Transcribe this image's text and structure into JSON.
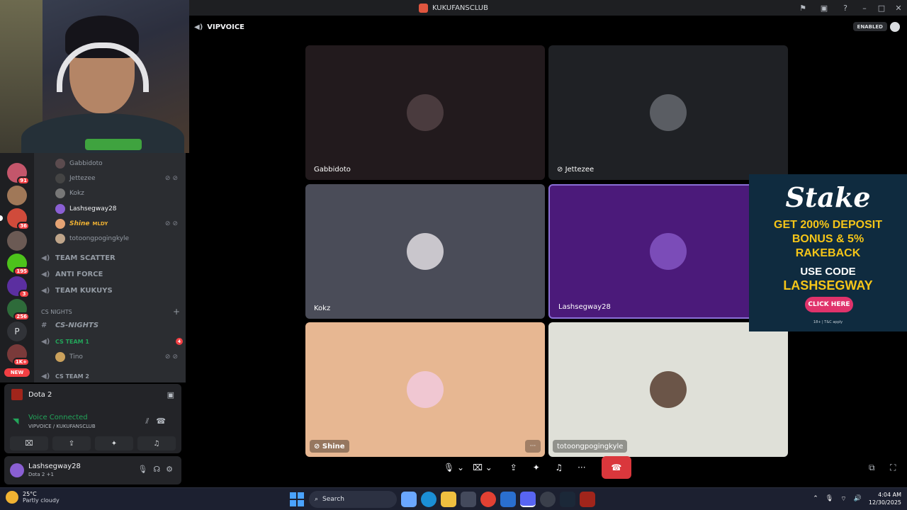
{
  "window": {
    "title": "KUKUFANSCLUB"
  },
  "call": {
    "channel_name": "VIPVOICE",
    "enabled_label": "ENABLED",
    "tiles": [
      {
        "name": "Gabbidoto",
        "bg": "#221a1d"
      },
      {
        "name": "Jettezee",
        "bg": "#1f2125",
        "muted_icon": "video-off-icon"
      },
      {
        "name": "Kokz",
        "bg": "#4a4c58"
      },
      {
        "name": "Lashsegway28",
        "bg": "#4b1a7a"
      },
      {
        "name": "Shine",
        "bg": "#e7b792",
        "muted_icon": "video-off-icon"
      },
      {
        "name": "totoongpogingkyle",
        "bg": "#dfe0d8"
      }
    ],
    "more_label": "···"
  },
  "members": [
    {
      "name": "Gabbidoto"
    },
    {
      "name": "Jettezee"
    },
    {
      "name": "Kokz"
    },
    {
      "name": "Lashsegway28"
    },
    {
      "name": "Shine",
      "tag": "MLDY"
    },
    {
      "name": "totoongpogingkyle"
    }
  ],
  "voice_channels": [
    {
      "name": "TEAM SCATTER"
    },
    {
      "name": "ANTI FORCE"
    },
    {
      "name": "TEAM KUKUYS"
    }
  ],
  "category": {
    "name": "CS NIGHTS",
    "text_channel": "CS-NIGHTS",
    "voice_1": "CS TEAM 1",
    "voice_1_badge": "4",
    "voice_1_member": "Tino",
    "voice_2": "CS TEAM 2"
  },
  "servers": [
    {
      "badge": "91"
    },
    {
      "badge": ""
    },
    {
      "badge": "36"
    },
    {
      "badge": ""
    },
    {
      "badge": "195"
    },
    {
      "badge": "3"
    },
    {
      "badge": "256"
    },
    {
      "letter": "P"
    },
    {
      "badge": "1K+"
    }
  ],
  "new_label": "NEW",
  "activity": {
    "game": "Dota 2"
  },
  "voice_panel": {
    "status": "Voice Connected",
    "location": "VIPVOICE / KUKUFANSCLUB"
  },
  "user": {
    "name": "Lashsegway28",
    "status": "Dota 2 +1"
  },
  "ad": {
    "brand": "Stake",
    "line1": "GET 200% DEPOSIT",
    "line2": "BONUS & 5%",
    "line3": "RAKEBACK",
    "line4": "USE CODE",
    "line5": "LASHSEGWAY",
    "cta": "CLICK HERE",
    "fine": "18+ | T&C apply"
  },
  "taskbar": {
    "temp": "25°C",
    "weather": "Partly cloudy",
    "search_placeholder": "Search",
    "time": "4:04 AM",
    "date": "12/30/2025"
  },
  "colors": {
    "accent_green": "#23a55a",
    "hangup_red": "#da373c",
    "ad_yellow": "#f5c518"
  }
}
